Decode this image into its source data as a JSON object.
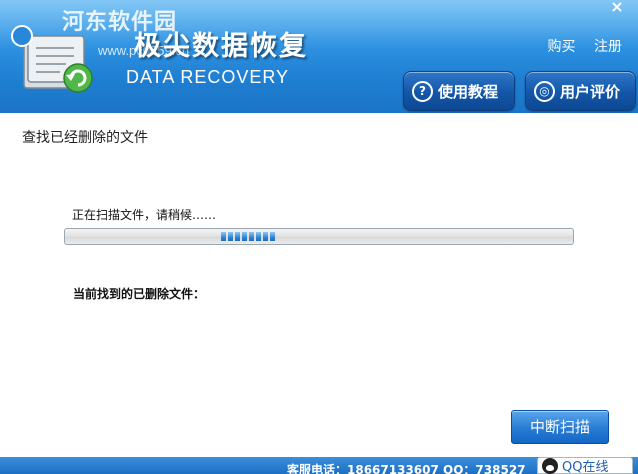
{
  "header": {
    "title": "极尖数据恢复",
    "subtitle": "DATA RECOVERY",
    "watermark_site": "河东软件园",
    "watermark_url": "www.pc0359.cn",
    "links": {
      "buy": "购买",
      "register": "注册"
    },
    "close_glyph": "×",
    "buttons": {
      "tutorial": {
        "label": "使用教程",
        "icon": "question-icon",
        "glyph": "?"
      },
      "review": {
        "label": "用户评价",
        "icon": "review-icon",
        "glyph": "◎"
      }
    },
    "colors": {
      "header_blue": "#2f93e2",
      "button_blue": "#1356a8"
    }
  },
  "main": {
    "heading": "查找已经删除的文件",
    "scan_status": "正在扫描文件，请稍候……",
    "progress_indicator": "indeterminate",
    "found_label": "当前找到的已删除文件：",
    "stop_button": "中断扫描"
  },
  "footer": {
    "contact": "客服电话：18667133607  QQ：738527",
    "qq_label": "QQ在线"
  }
}
